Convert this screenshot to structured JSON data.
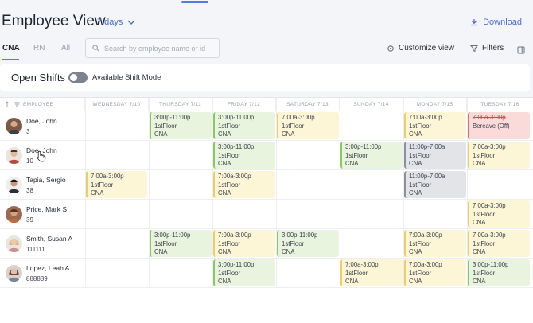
{
  "header": {
    "title": "Employee View",
    "range": "7 days",
    "download": "Download"
  },
  "tabs": [
    {
      "label": "CNA",
      "active": true
    },
    {
      "label": "RN",
      "active": false
    },
    {
      "label": "All",
      "active": false
    }
  ],
  "search": {
    "placeholder": "Search by employee name or id",
    "value": ""
  },
  "toolbar": {
    "customize": "Customize view",
    "filters": "Filters"
  },
  "open_shifts": {
    "label": "Open Shifts",
    "toggle_label": "Available Shift Mode",
    "toggle_on": false
  },
  "columns": {
    "employee": "EMPLOYEE",
    "days": [
      "WEDNESDAY 7/10",
      "THURSDAY 7/11",
      "FRIDAY 7/12",
      "SATURDAY 7/13",
      "SUNDAY 7/14",
      "MONDAY 7/15",
      "TUESDAY 7/16"
    ]
  },
  "employees": [
    {
      "name": "Doe, John",
      "id": "3"
    },
    {
      "name": "Doe, John",
      "id": "10"
    },
    {
      "name": "Tapia, Sergio",
      "id": "38"
    },
    {
      "name": "Price, Mark S",
      "id": "39"
    },
    {
      "name": "Smith, Susan A",
      "id": "111111"
    },
    {
      "name": "Lopez, Leah A",
      "id": "888889"
    }
  ],
  "shifts": [
    {
      "row": 0,
      "day": 1,
      "time": "3:00p-11:00p",
      "floor": "1stFloor",
      "role": "CNA",
      "color": "green"
    },
    {
      "row": 0,
      "day": 2,
      "time": "3:00p-11:00p",
      "floor": "1stFloor",
      "role": "CNA",
      "color": "green"
    },
    {
      "row": 0,
      "day": 3,
      "time": "7:00a-3:00p",
      "floor": "1stFloor",
      "role": "CNA",
      "color": "yellow"
    },
    {
      "row": 0,
      "day": 5,
      "time": "7:00a-3:00p",
      "floor": "1stFloor",
      "role": "CNA",
      "color": "yellow"
    },
    {
      "row": 0,
      "day": 6,
      "time": "7:00a-3:00p",
      "floor": "Bereave (Off)",
      "role": "",
      "color": "red",
      "strike": true
    },
    {
      "row": 1,
      "day": 2,
      "time": "3:00p-11:00p",
      "floor": "1stFloor",
      "role": "CNA",
      "color": "green"
    },
    {
      "row": 1,
      "day": 4,
      "time": "3:00p-11:00p",
      "floor": "1stFloor",
      "role": "CNA",
      "color": "green"
    },
    {
      "row": 1,
      "day": 5,
      "time": "11:00p-7:00a",
      "floor": "1stFloor",
      "role": "CNA",
      "color": "gray"
    },
    {
      "row": 1,
      "day": 6,
      "time": "7:00a-3:00p",
      "floor": "1stFloor",
      "role": "CNA",
      "color": "yellow"
    },
    {
      "row": 2,
      "day": 0,
      "time": "7:00a-3:00p",
      "floor": "1stFloor",
      "role": "CNA",
      "color": "yellow"
    },
    {
      "row": 2,
      "day": 2,
      "time": "7:00a-3:00p",
      "floor": "1stFloor",
      "role": "CNA",
      "color": "yellow"
    },
    {
      "row": 2,
      "day": 5,
      "time": "11:00p-7:00a",
      "floor": "1stFloor",
      "role": "CNA",
      "color": "gray"
    },
    {
      "row": 3,
      "day": 6,
      "time": "7:00a-3:00p",
      "floor": "1stFloor",
      "role": "CNA",
      "color": "yellow"
    },
    {
      "row": 4,
      "day": 1,
      "time": "3:00p-11:00p",
      "floor": "1stFloor",
      "role": "CNA",
      "color": "green"
    },
    {
      "row": 4,
      "day": 2,
      "time": "7:00a-3:00p",
      "floor": "1stFloor",
      "role": "CNA",
      "color": "yellow"
    },
    {
      "row": 4,
      "day": 3,
      "time": "3:00p-11:00p",
      "floor": "1stFloor",
      "role": "CNA",
      "color": "green"
    },
    {
      "row": 4,
      "day": 5,
      "time": "7:00a-3:00p",
      "floor": "1stFloor",
      "role": "CNA",
      "color": "yellow"
    },
    {
      "row": 4,
      "day": 6,
      "time": "7:00a-3:00p",
      "floor": "1stFloor",
      "role": "CNA",
      "color": "yellow"
    },
    {
      "row": 5,
      "day": 2,
      "time": "3:00p-11:00p",
      "floor": "1stFloor",
      "role": "CNA",
      "color": "green"
    },
    {
      "row": 5,
      "day": 4,
      "time": "7:00a-3:00p",
      "floor": "1stFloor",
      "role": "CNA",
      "color": "yellow"
    },
    {
      "row": 5,
      "day": 5,
      "time": "7:00a-3:00p",
      "floor": "1stFloor",
      "role": "CNA",
      "color": "yellow"
    },
    {
      "row": 5,
      "day": 6,
      "time": "3:00p-11:00p",
      "floor": "1stFloor",
      "role": "CNA",
      "color": "green"
    }
  ],
  "colors": {
    "accent": "#4f7ee0",
    "online": "#3fb56a"
  }
}
